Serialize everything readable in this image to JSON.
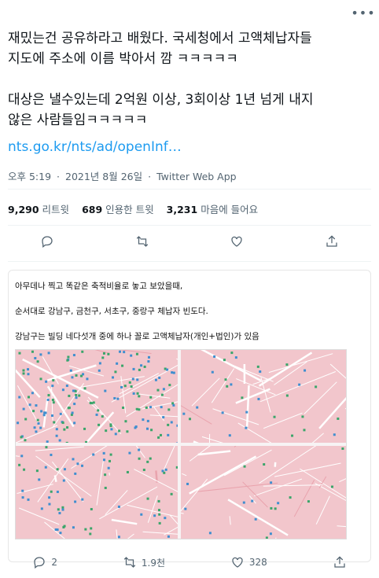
{
  "header": {
    "more_icon": "more-horizontal-icon"
  },
  "tweet": {
    "text": "재밌는건 공유하라고 배웠다. 국세청에서 고액체납자들\n지도에 주소에 이름 박아서 깜 ㅋㅋㅋㅋㅋ\n\n대상은 낼수있는데 2억원 이상, 3회이상 1년 넘게 내지\n않은 사람들임ㅋㅋㅋㅋㅋ",
    "link": "nts.go.kr/nts/ad/openInf…",
    "time": "오후 5:19",
    "date": "2021년 8월 26일",
    "source": "Twitter Web App",
    "sep": "·"
  },
  "stats": {
    "retweets": {
      "count": "9,290",
      "label": "리트윗"
    },
    "quotes": {
      "count": "689",
      "label": "인용한 트윗"
    },
    "likes": {
      "count": "3,231",
      "label": "마음에 들어요"
    }
  },
  "reply": {
    "line1": "아무데나 찍고 똑같은 축적비율로 놓고 보았을때,",
    "line2": "순서대로 강남구, 금천구, 서초구, 중랑구 체납자 빈도다.",
    "line3": "강남구는 빌딩 네다섯개 중에 하나 꼴로 고액체납자(개인+법인)가 있음",
    "counts": {
      "reply": "2",
      "retweet": "1.9천",
      "like": "328"
    }
  },
  "colors": {
    "accent": "#1d9bf0",
    "secondary": "#536471",
    "map_pink": "#f2c6cc"
  }
}
